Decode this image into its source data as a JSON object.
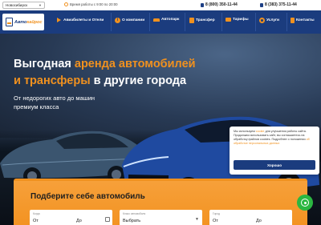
{
  "topbar": {
    "city": "Новосибирск",
    "hours": "Время работы с 9:00 по 20:00",
    "phone1": "8 (800) 350-11-44",
    "phone2": "8 (383) 375-11-44"
  },
  "logo": {
    "part1": "Авто",
    "part2": "кайрос"
  },
  "nav": {
    "items": [
      {
        "label": "Авиабилеты и Отели",
        "icon": "plane-icon"
      },
      {
        "label": "О компании",
        "icon": "info-icon"
      },
      {
        "label": "Автопарк",
        "icon": "car-icon"
      },
      {
        "label": "Трансфер",
        "icon": "bus-icon"
      },
      {
        "label": "Тарифы",
        "icon": "tag-icon"
      },
      {
        "label": "Услуги",
        "icon": "gear-icon"
      },
      {
        "label": "Контакты",
        "icon": "phone-icon"
      }
    ]
  },
  "hero": {
    "title_line1_a": "Выгодная ",
    "title_line1_b": "аренда автомобилей",
    "title_line2_a": "и трансферы",
    "title_line2_b": " в другие города",
    "subtitle": "От недорогих авто до машин премиум класса"
  },
  "cookie": {
    "text1": "Мы используем ",
    "link1": "cookie",
    "text2": " для улучшения работы сайта. Продолжая использовать сайт, вы соглашаетесь на обработку файлов cookies. Подробнее о положении ",
    "link2": "об обработке персональных данных",
    "button": "Хорошо"
  },
  "form": {
    "title": "Подберите себе автомобиль",
    "date_label": "Когда",
    "date_from": "От",
    "date_to": "До",
    "class_label": "Класс автомобиля",
    "class_value": "Выбрать",
    "city_label": "Город",
    "city_from": "От",
    "city_to": "До"
  },
  "colors": {
    "accent": "#f0911f",
    "brand": "#1b3c7e",
    "whatsapp": "#2bb741"
  }
}
